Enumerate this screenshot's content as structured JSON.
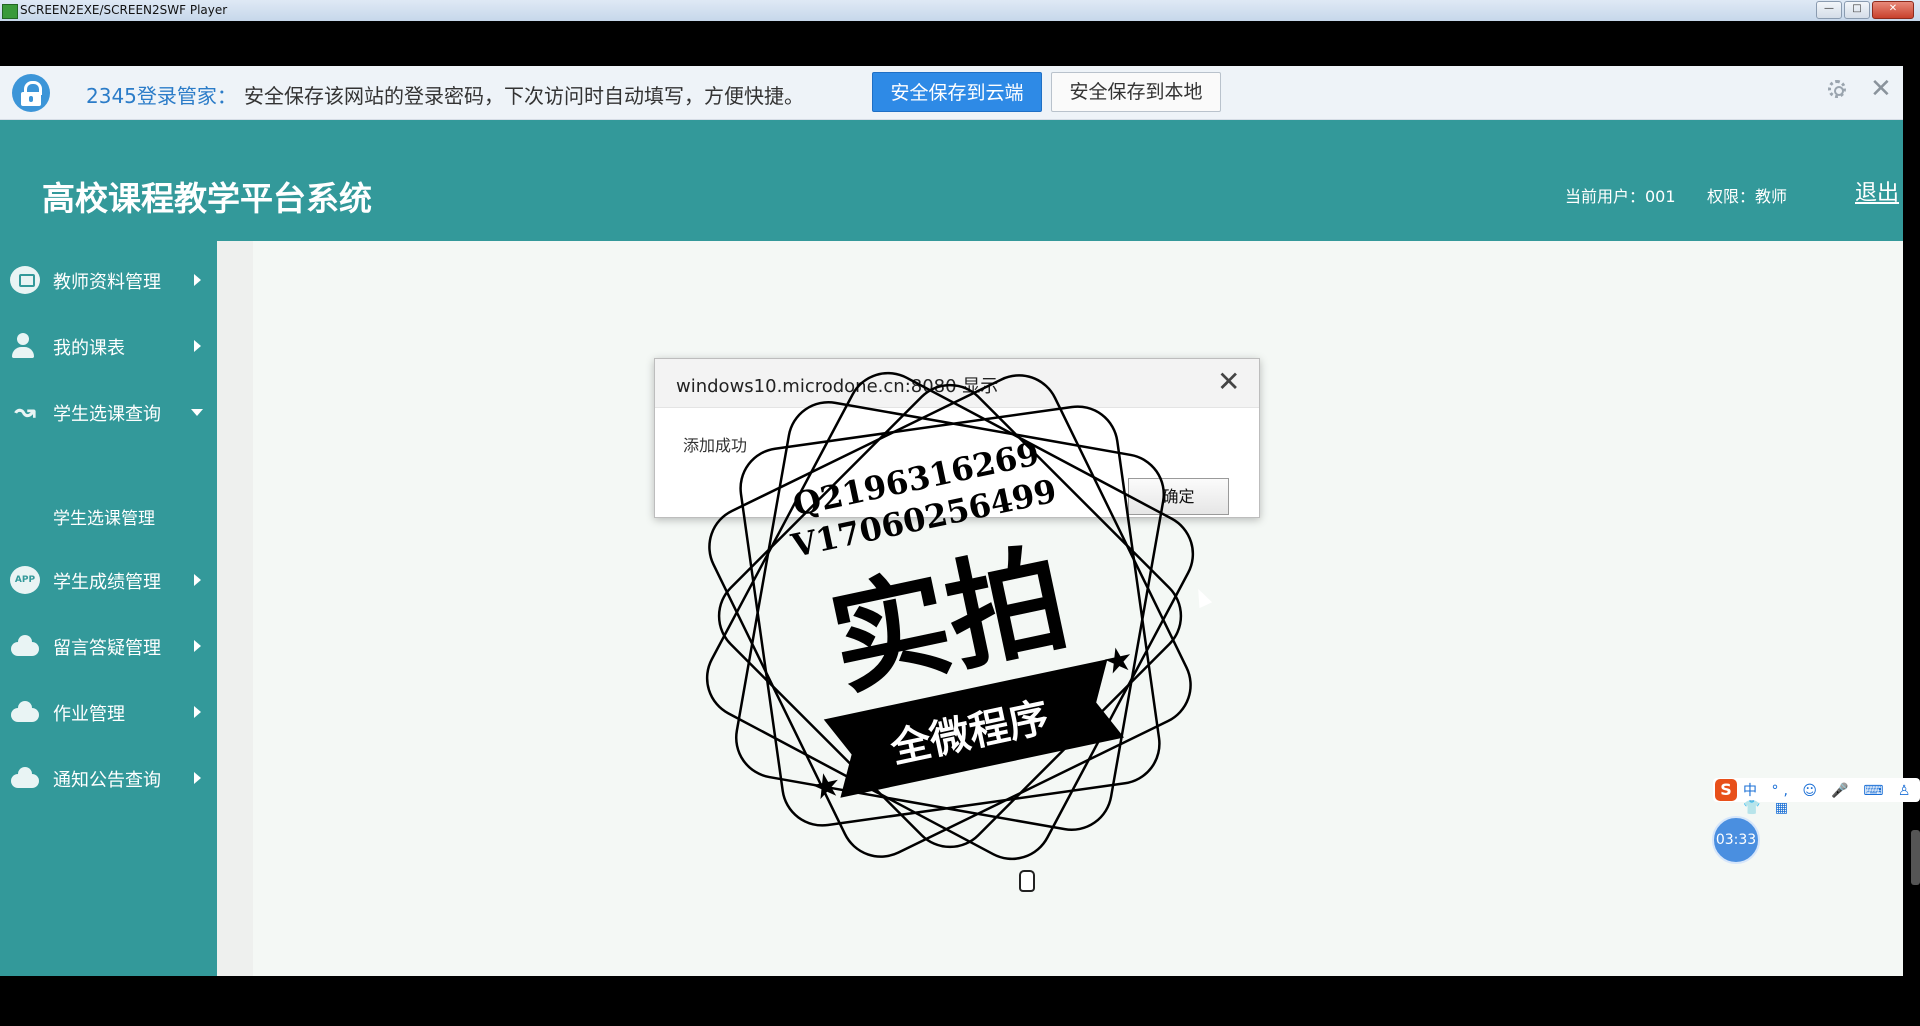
{
  "window": {
    "title": "SCREEN2EXE/SCREEN2SWF Player"
  },
  "password_bar": {
    "brand": "2345登录管家：",
    "message": "安全保存该网站的登录密码，下次访问时自动填写，方便快捷。",
    "save_cloud_label": "安全保存到云端",
    "save_local_label": "安全保存到本地"
  },
  "header": {
    "title": "高校课程教学平台系统",
    "current_user": "当前用户：001",
    "role": "权限：教师",
    "logout_label": "退出"
  },
  "sidebar": {
    "items": [
      {
        "label": "教师资料管理",
        "icon": "monitor-icon"
      },
      {
        "label": "我的课表",
        "icon": "user-icon"
      },
      {
        "label": "学生选课查询",
        "icon": "course-icon",
        "expanded": true
      },
      {
        "label": "学生成绩管理",
        "icon": "app-icon"
      },
      {
        "label": "留言答疑管理",
        "icon": "cloud-icon"
      },
      {
        "label": "作业管理",
        "icon": "cloud-icon"
      },
      {
        "label": "通知公告查询",
        "icon": "cloud-icon"
      }
    ],
    "sub_item_label": "学生选课管理"
  },
  "dialog": {
    "title": "windows10.microdone.cn:8080 显示",
    "message": "添加成功",
    "ok_label": "确定"
  },
  "watermark": {
    "line1": "Q2196316269",
    "line2": "V17060256499",
    "main": "实拍",
    "banner": "全微程序"
  },
  "ime": {
    "logo": "S",
    "mode": "中"
  },
  "timer": {
    "value": "03:33"
  },
  "colors": {
    "teal": "#33999a",
    "blue_button": "#2e8ae6"
  }
}
